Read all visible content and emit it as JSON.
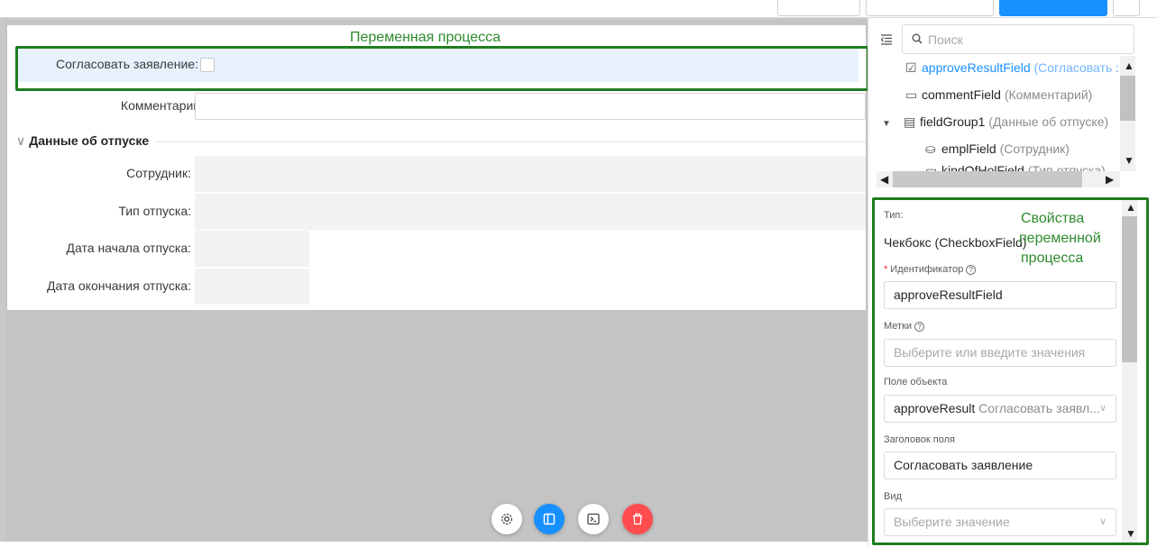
{
  "canvas": {
    "process_caption": "Переменная процесса",
    "form": {
      "rows": [
        {
          "label": "Согласовать заявление:"
        },
        {
          "label": "Комментарий:"
        }
      ],
      "group": {
        "title": "Данные об отпуске",
        "fields": [
          {
            "label": "Сотрудник:"
          },
          {
            "label": "Тип отпуска:"
          },
          {
            "label": "Дата начала отпуска:"
          },
          {
            "label": "Дата окончания отпуска:"
          }
        ]
      }
    },
    "fabs": [
      {
        "icon": "gear-icon",
        "color": "#ffffff"
      },
      {
        "icon": "layout-icon",
        "color": "#1890ff"
      },
      {
        "icon": "terminal-icon",
        "color": "#ffffff"
      },
      {
        "icon": "trash-icon",
        "color": "#ff4d4f"
      }
    ]
  },
  "tree": {
    "search_placeholder": "Поиск",
    "nodes": [
      {
        "name": "approveResultField",
        "sub": "(Согласовать зая",
        "icon": "checkbox-icon",
        "selected": true
      },
      {
        "name": "commentField",
        "sub": "(Комментарий)",
        "icon": "textfield-icon"
      },
      {
        "name": "fieldGroup1",
        "sub": "(Данные об отпуске)",
        "icon": "group-icon"
      },
      {
        "name": "emplField",
        "sub": "(Сотрудник)",
        "icon": "user-field-icon"
      },
      {
        "name": "kindOfHolField",
        "sub": "(Тип отпуска)",
        "icon": "select-icon"
      }
    ]
  },
  "props": {
    "caption_lines": [
      "Свойства",
      "переменной",
      "процесса"
    ],
    "type_label": "Тип:",
    "type_value": "Чекбокс (CheckboxField)",
    "id_label": "Идентификатор",
    "id_value": "approveResultField",
    "tags_label": "Метки",
    "tags_placeholder": "Выберите или введите значения",
    "object_field_label": "Поле объекта",
    "object_field_value": "approveResult",
    "object_field_dim": "Согласовать заявл...",
    "field_title_label": "Заголовок поля",
    "field_title_value": "Согласовать заявление",
    "view_label": "Вид",
    "view_placeholder": "Выберите значение"
  }
}
